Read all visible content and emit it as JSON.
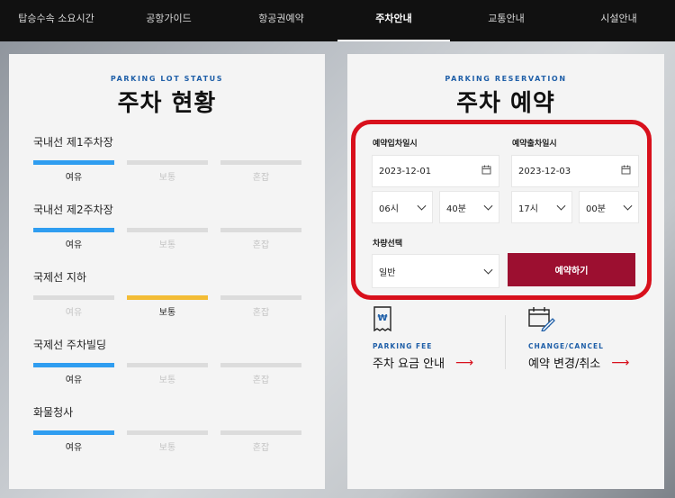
{
  "nav": {
    "items": [
      {
        "label": "탑승수속 소요시간"
      },
      {
        "label": "공항가이드"
      },
      {
        "label": "항공권예약"
      },
      {
        "label": "주차안내"
      },
      {
        "label": "교통안내"
      },
      {
        "label": "시설안내"
      }
    ],
    "active_index": 3
  },
  "status": {
    "eyebrow": "PARKING LOT STATUS",
    "title": "주차 현황",
    "level_labels": [
      "여유",
      "보통",
      "혼잡"
    ],
    "lots": [
      {
        "name": "국내선 제1주차장",
        "level": "여유"
      },
      {
        "name": "국내선 제2주차장",
        "level": "여유"
      },
      {
        "name": "국제선 지하",
        "level": "보통"
      },
      {
        "name": "국제선 주차빌딩",
        "level": "여유"
      },
      {
        "name": "화물청사",
        "level": "여유"
      }
    ]
  },
  "reservation": {
    "eyebrow": "PARKING RESERVATION",
    "title": "주차 예약",
    "entry_label": "예약입차일시",
    "exit_label": "예약출차일시",
    "entry_date": "2023-12-01",
    "exit_date": "2023-12-03",
    "entry_hour": "06시",
    "entry_min": "40분",
    "exit_hour": "17시",
    "exit_min": "00분",
    "vehicle_label": "차량선택",
    "vehicle_value": "일반",
    "submit_label": "예약하기"
  },
  "links": [
    {
      "eyebrow": "PARKING FEE",
      "text": "주차 요금 안내"
    },
    {
      "eyebrow": "CHANGE/CANCEL",
      "text": "예약 변경/취소"
    }
  ],
  "colors": {
    "accent_red": "#d8101c",
    "button_maroon": "#9c0f30",
    "status_blue": "#2f9df0",
    "status_yellow": "#f3bc35",
    "eyebrow_blue": "#1f5fa8"
  }
}
